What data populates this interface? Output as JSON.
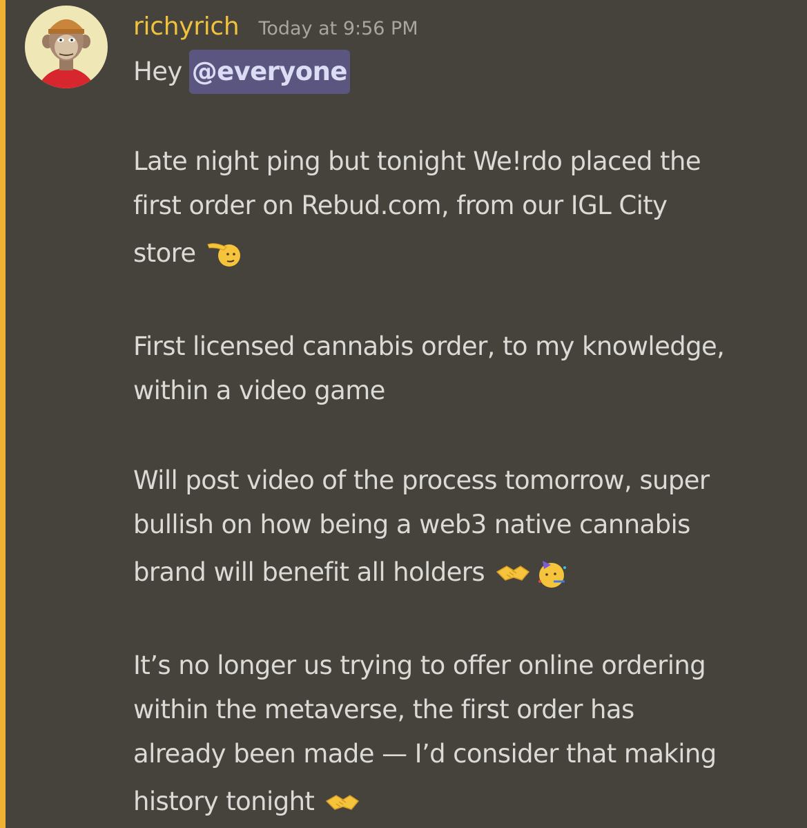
{
  "message": {
    "username": "richyrich",
    "timestamp": "Today at 9:56 PM",
    "greeting": "Hey",
    "mention": "@everyone",
    "lines": [
      "Late night ping but tonight We!rdo placed the",
      "first order on Rebud.com, from our IGL City",
      "store",
      "First licensed cannabis order, to my knowledge,",
      "within a video game",
      "Will post video of the process tomorrow, super",
      "bullish on how being a web3 native cannabis",
      "brand will benefit all holders",
      "It’s no longer us trying to offer online ordering",
      "within the metaverse, the first order has",
      "already been made — I’d consider that making",
      "history tonight"
    ],
    "emojis": {
      "store_line": "saluting-face",
      "holders_line": [
        "handshake",
        "partying-face"
      ],
      "history_line": "handshake"
    }
  },
  "colors": {
    "background": "#46423c",
    "mention_bar": "#f0b232",
    "username": "#f0c23e",
    "timestamp": "#a9a6a1",
    "text": "#dbdad6",
    "mention_bg": "#5a5680"
  }
}
